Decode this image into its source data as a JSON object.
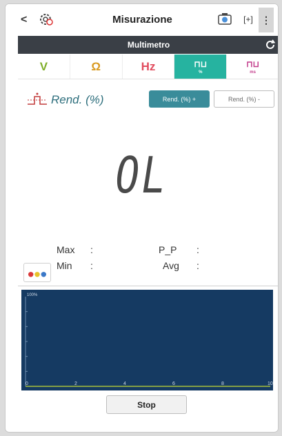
{
  "topbar": {
    "back_label": "<",
    "title": "Misurazione",
    "fullscreen_label": "[+]",
    "more_label": "⋮"
  },
  "header": {
    "title": "Multimetro"
  },
  "tabs": [
    {
      "label": "V",
      "sub": ""
    },
    {
      "label": "Ω",
      "sub": ""
    },
    {
      "label": "Hz",
      "sub": ""
    },
    {
      "label": "⊓⊔",
      "sub": "%"
    },
    {
      "label": "⊓⊔",
      "sub": "ms"
    }
  ],
  "mode": {
    "label": "Rend. (%)",
    "pos_button": "Rend. (%) +",
    "neg_button": "Rend. (%) -"
  },
  "reading": {
    "value": "OL"
  },
  "stats": {
    "max_label": "Max",
    "min_label": "Min",
    "pp_label": "P_P",
    "avg_label": "Avg",
    "colon": ":"
  },
  "colors": {
    "accent": "#26b3a0",
    "header_bg": "#3a3f46",
    "chart_bg": "#153a62"
  },
  "chart_data": {
    "type": "line",
    "ylabel": "100%",
    "x_ticks": [
      "0",
      "2",
      "4",
      "6",
      "8",
      "10"
    ],
    "xlim": [
      0,
      10
    ],
    "ylim": [
      0,
      100
    ],
    "series": [
      {
        "values": []
      }
    ]
  },
  "footer": {
    "stop_label": "Stop"
  }
}
